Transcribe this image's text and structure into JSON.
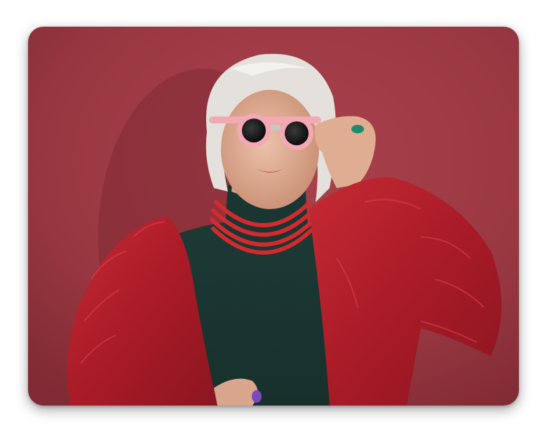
{
  "photo": {
    "subject": "woman-portrait",
    "colors": {
      "background": "#9e3a44",
      "coat": "#b81f2b",
      "sweater": "#1f3d38",
      "necklace": "#d42a2e",
      "glasses_frame": "#f2a9b4",
      "hair": "#e4e1dd",
      "skin": "#e3b59b"
    }
  }
}
